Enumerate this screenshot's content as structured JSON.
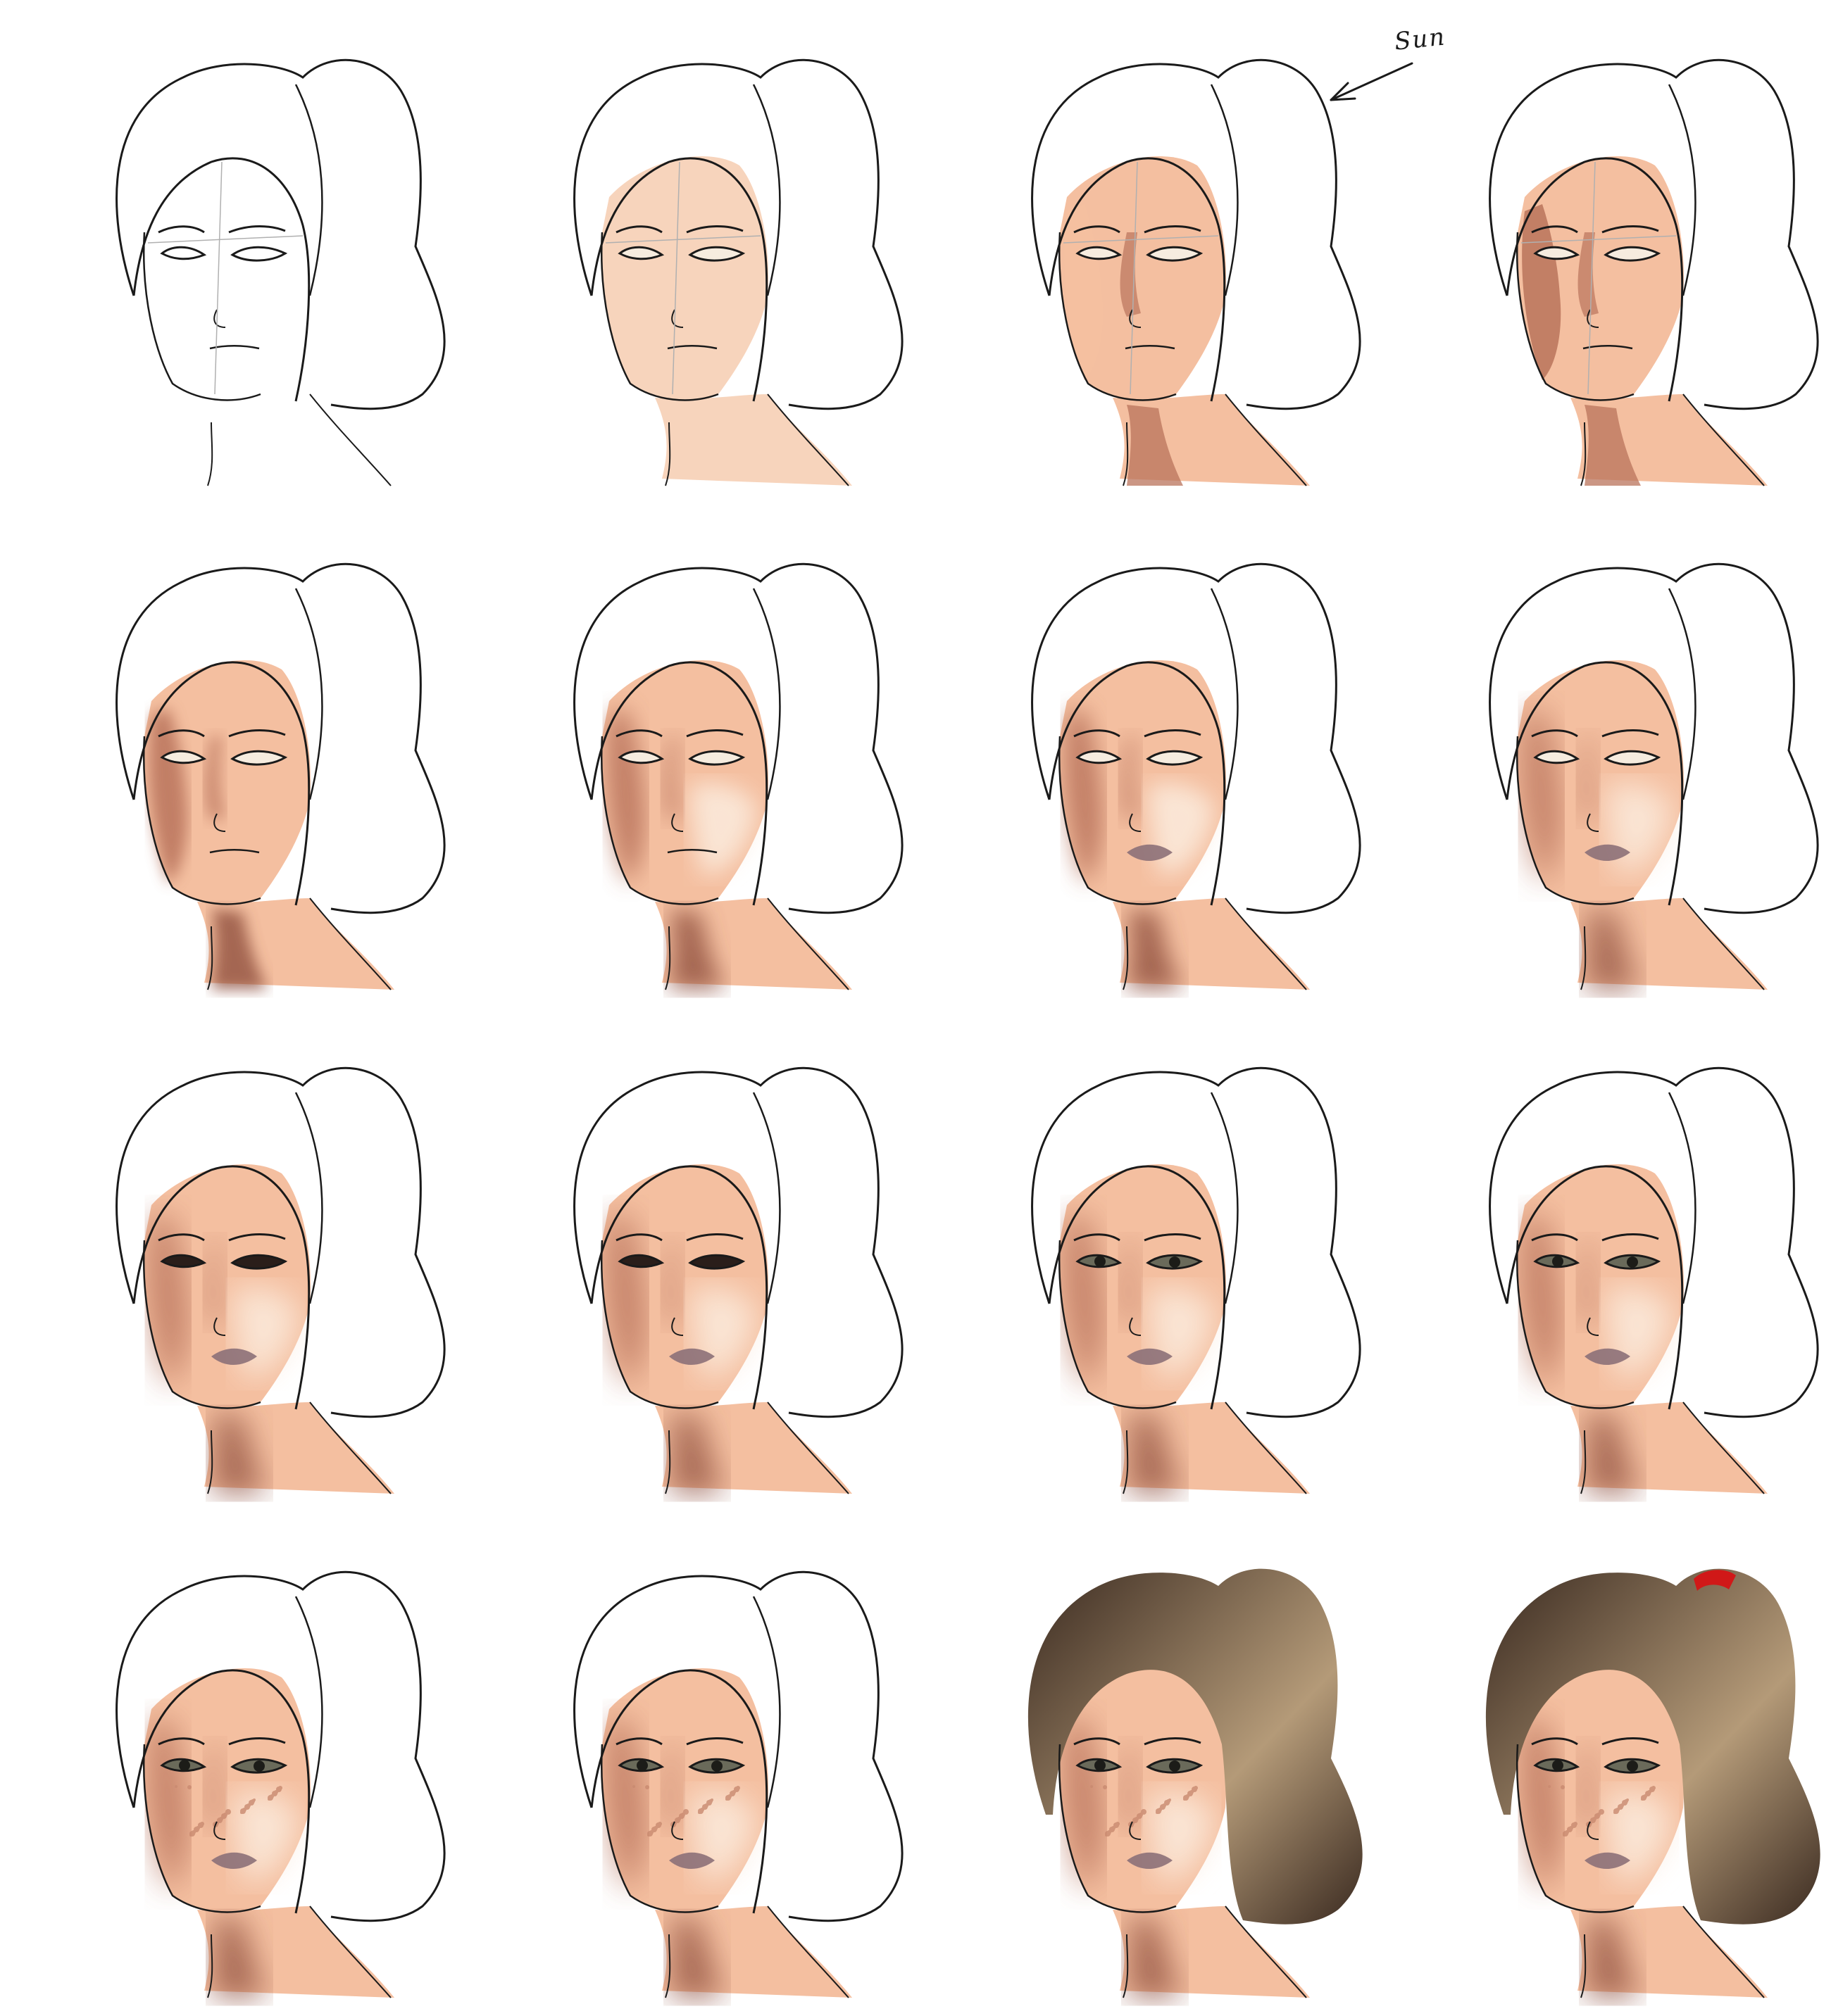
{
  "annotation": {
    "label": "Sun",
    "arrow_icon": "arrow-down-left-icon"
  },
  "colors": {
    "line": "#1a1a1a",
    "skin_base": "#f7d4bc",
    "skin_warm": "#f4bfa0",
    "skin_shadow": "#b9735b",
    "skin_deep": "#8a4a38",
    "highlight": "#fbe9da",
    "lips": "#8c7078",
    "freckles": "#c98a70",
    "hair_dark": "#3a2a20",
    "hair_light": "#b49a78",
    "hair_tie": "#d01818"
  },
  "stages": [
    {
      "id": 1,
      "skin": false,
      "shadow": 0,
      "blend": 0,
      "lips": false,
      "eyes": "line",
      "freckles": false,
      "hair": false,
      "tie": false
    },
    {
      "id": 2,
      "skin": true,
      "shadow": 0,
      "blend": 0,
      "lips": false,
      "eyes": "line",
      "freckles": false,
      "hair": false,
      "tie": false
    },
    {
      "id": 3,
      "skin": true,
      "shadow": 1,
      "blend": 0,
      "lips": false,
      "eyes": "line",
      "freckles": false,
      "hair": false,
      "tie": false
    },
    {
      "id": 4,
      "skin": true,
      "shadow": 2,
      "blend": 0,
      "lips": false,
      "eyes": "line",
      "freckles": false,
      "hair": false,
      "tie": false
    },
    {
      "id": 5,
      "skin": true,
      "shadow": 3,
      "blend": 1,
      "lips": false,
      "eyes": "line",
      "freckles": false,
      "hair": false,
      "tie": false
    },
    {
      "id": 6,
      "skin": true,
      "shadow": 3,
      "blend": 2,
      "lips": false,
      "eyes": "line",
      "freckles": false,
      "hair": false,
      "tie": false
    },
    {
      "id": 7,
      "skin": true,
      "shadow": 3,
      "blend": 2,
      "lips": true,
      "eyes": "line",
      "freckles": false,
      "hair": false,
      "tie": false
    },
    {
      "id": 8,
      "skin": true,
      "shadow": 3,
      "blend": 3,
      "lips": true,
      "eyes": "line",
      "freckles": false,
      "hair": false,
      "tie": false
    },
    {
      "id": 9,
      "skin": true,
      "shadow": 3,
      "blend": 3,
      "lips": true,
      "eyes": "dark",
      "freckles": false,
      "hair": false,
      "tie": false
    },
    {
      "id": 10,
      "skin": true,
      "shadow": 3,
      "blend": 3,
      "lips": true,
      "eyes": "dark",
      "freckles": false,
      "hair": false,
      "tie": false
    },
    {
      "id": 11,
      "skin": true,
      "shadow": 3,
      "blend": 3,
      "lips": true,
      "eyes": "iris",
      "freckles": false,
      "hair": false,
      "tie": false
    },
    {
      "id": 12,
      "skin": true,
      "shadow": 3,
      "blend": 3,
      "lips": true,
      "eyes": "iris",
      "freckles": false,
      "hair": false,
      "tie": false
    },
    {
      "id": 13,
      "skin": true,
      "shadow": 3,
      "blend": 3,
      "lips": true,
      "eyes": "iris",
      "freckles": true,
      "hair": false,
      "tie": false
    },
    {
      "id": 14,
      "skin": true,
      "shadow": 3,
      "blend": 3,
      "lips": true,
      "eyes": "iris",
      "freckles": true,
      "hair": false,
      "tie": false
    },
    {
      "id": 15,
      "skin": true,
      "shadow": 3,
      "blend": 3,
      "lips": true,
      "eyes": "iris",
      "freckles": true,
      "hair": true,
      "tie": false
    },
    {
      "id": 16,
      "skin": true,
      "shadow": 3,
      "blend": 3,
      "lips": true,
      "eyes": "iris",
      "freckles": true,
      "hair": true,
      "tie": true
    }
  ]
}
